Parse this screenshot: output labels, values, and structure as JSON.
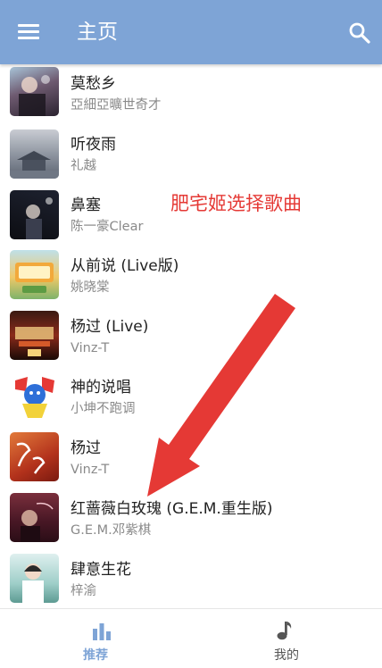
{
  "header": {
    "title": "主页",
    "menu_icon": "menu-icon",
    "search_icon": "search-icon"
  },
  "theme": {
    "accent": "#7ea4d6",
    "annotation": "#e53935"
  },
  "songs": [
    {
      "title": "莫愁乡",
      "artist": "亞細亞曠世奇才"
    },
    {
      "title": "听夜雨",
      "artist": "礼越"
    },
    {
      "title": "鼻塞",
      "artist": "陈一豪Clear"
    },
    {
      "title": "从前说 (Live版)",
      "artist": "姚晓棠"
    },
    {
      "title": "杨过 (Live)",
      "artist": "Vinz-T"
    },
    {
      "title": "神的说唱",
      "artist": "小坤不跑调"
    },
    {
      "title": "杨过",
      "artist": "Vinz-T"
    },
    {
      "title": "红蔷薇白玫瑰 (G.E.M.重生版)",
      "artist": "G.E.M.邓紫棋"
    },
    {
      "title": "肆意生花",
      "artist": "梓渝"
    }
  ],
  "annotation": {
    "text": "肥宅姬选择歌曲"
  },
  "bottom_nav": [
    {
      "label": "推荐",
      "icon": "bar-chart-icon",
      "active": true
    },
    {
      "label": "我的",
      "icon": "music-note-icon",
      "active": false
    }
  ]
}
